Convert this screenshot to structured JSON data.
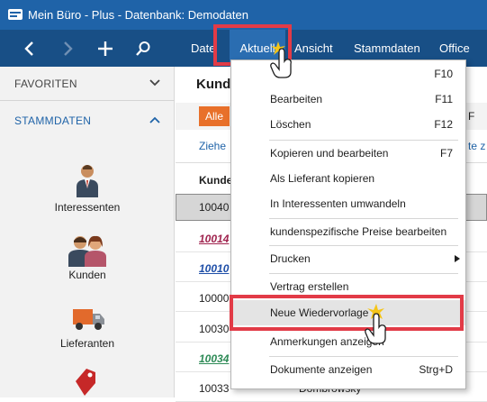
{
  "window": {
    "title": "Mein Büro - Plus - Datenbank: Demodaten"
  },
  "colors": {
    "titlebar": "#1f63a8",
    "navbar": "#184f86",
    "accent_orange": "#e8702a",
    "highlight_red": "#e23b47"
  },
  "nav": {
    "buttons": [
      "back-icon",
      "forward-icon",
      "plus-icon",
      "search-icon"
    ],
    "menu": [
      "Date",
      "Aktuell",
      "Ansicht",
      "Stammdaten",
      "Office"
    ]
  },
  "sidebar": {
    "favoriten": "FAVORITEN",
    "stammdaten": "STAMMDATEN",
    "tiles": [
      "Interessenten",
      "Kunden",
      "Lieferanten"
    ]
  },
  "main": {
    "title": "Kund",
    "chip": "Alle",
    "filter_right": "F",
    "group_hint": "Ziehe",
    "group_hint_right": "te z",
    "column_header": "Kunde",
    "rows": [
      {
        "id": "10040",
        "name": ""
      },
      {
        "id": "10014",
        "name": ""
      },
      {
        "id": "10010",
        "name": ""
      },
      {
        "id": "10000",
        "name": ""
      },
      {
        "id": "10030",
        "name": ""
      },
      {
        "id": "10034",
        "name": ""
      },
      {
        "id": "10033",
        "name": "Dombrowsky"
      }
    ]
  },
  "context_menu": {
    "items": [
      {
        "label": "",
        "key": "F10"
      },
      {
        "label": "Bearbeiten",
        "key": "F11"
      },
      {
        "label": "Löschen",
        "key": "F12"
      },
      {
        "label": "Kopieren und bearbeiten",
        "key": "F7"
      },
      {
        "label": "Als Lieferant kopieren",
        "key": ""
      },
      {
        "label": "In Interessenten umwandeln",
        "key": ""
      },
      {
        "label": "kundenspezifische Preise bearbeiten",
        "key": ""
      },
      {
        "label": "Drucken",
        "key": ""
      },
      {
        "label": "Vertrag erstellen",
        "key": ""
      },
      {
        "label": "Neue Wiedervorlage",
        "key": ""
      },
      {
        "label": "Anmerkungen anzeigen",
        "key": ""
      },
      {
        "label": "Dokumente anzeigen",
        "key": "Strg+D"
      }
    ]
  }
}
